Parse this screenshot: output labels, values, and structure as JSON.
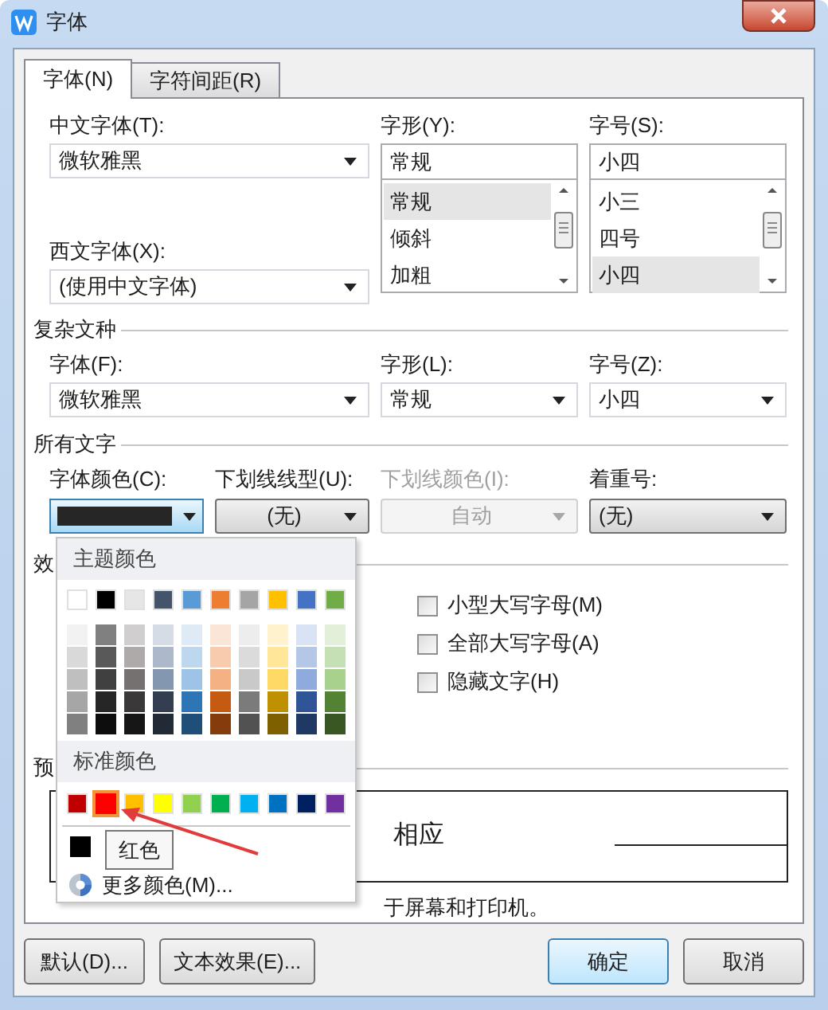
{
  "window": {
    "title": "字体"
  },
  "tabs": [
    {
      "label": "字体(N)",
      "selected": true
    },
    {
      "label": "字符间距(R)",
      "selected": false
    }
  ],
  "fonts": {
    "chinese_font": {
      "label": "中文字体(T):",
      "value": "微软雅黑"
    },
    "western_font": {
      "label": "西文字体(X):",
      "value": "(使用中文字体)"
    },
    "style": {
      "label": "字形(Y):",
      "value": "常规",
      "options": [
        {
          "label": "常规",
          "selected": true
        },
        {
          "label": "倾斜",
          "selected": false
        },
        {
          "label": "加粗",
          "selected": false
        }
      ]
    },
    "size": {
      "label": "字号(S):",
      "value": "小四",
      "options": [
        {
          "label": "小三",
          "selected": false
        },
        {
          "label": "四号",
          "selected": false
        },
        {
          "label": "小四",
          "selected": true
        }
      ]
    }
  },
  "complex": {
    "title": "复杂文种",
    "fields": [
      {
        "label": "字体(F):",
        "value": "微软雅黑"
      },
      {
        "label": "字形(L):",
        "value": "常规"
      },
      {
        "label": "字号(Z):",
        "value": "小四"
      }
    ]
  },
  "all_text": {
    "title": "所有文字",
    "fields": [
      {
        "kind": "color",
        "label": "字体颜色(C):",
        "color": "#262626",
        "disabled": false
      },
      {
        "kind": "button",
        "label": "下划线线型(U):",
        "value": "(无)",
        "disabled": false
      },
      {
        "kind": "button",
        "label": "下划线颜色(I):",
        "value": "自动",
        "disabled": true
      },
      {
        "kind": "dropdown",
        "label": "着重号:",
        "value": "(无)",
        "disabled": false
      }
    ]
  },
  "effects": {
    "title": "效",
    "checkboxes": [
      {
        "label": "小型大写字母(M)",
        "checked": false
      },
      {
        "label": "全部大写字母(A)",
        "checked": false
      },
      {
        "label": "隐藏文字(H)",
        "checked": false
      }
    ]
  },
  "preview": {
    "title": "预",
    "sample": "相应"
  },
  "font_info": "于屏幕和打印机。",
  "color_menu": {
    "theme_title": "主题颜色",
    "theme_colors": [
      {
        "color": "#ffffff"
      },
      {
        "color": "#000000"
      },
      {
        "color": "#e7e6e6"
      },
      {
        "color": "#44546a"
      },
      {
        "color": "#5b9bd5"
      },
      {
        "color": "#ed7d31"
      },
      {
        "color": "#a5a5a5"
      },
      {
        "color": "#ffc000"
      },
      {
        "color": "#4472c4"
      },
      {
        "color": "#70ad47"
      }
    ],
    "shades": [
      {
        "colors": [
          {
            "color": "#f2f2f2"
          },
          {
            "color": "#d9d9d9"
          },
          {
            "color": "#bfbfbf"
          },
          {
            "color": "#a6a6a6"
          },
          {
            "color": "#808080"
          }
        ]
      },
      {
        "colors": [
          {
            "color": "#808080"
          },
          {
            "color": "#595959"
          },
          {
            "color": "#404040"
          },
          {
            "color": "#262626"
          },
          {
            "color": "#0d0d0d"
          }
        ]
      },
      {
        "colors": [
          {
            "color": "#d0cece"
          },
          {
            "color": "#aeaaaa"
          },
          {
            "color": "#757171"
          },
          {
            "color": "#3a3838"
          },
          {
            "color": "#171616"
          }
        ]
      },
      {
        "colors": [
          {
            "color": "#d6dce5"
          },
          {
            "color": "#adb9ca"
          },
          {
            "color": "#8497b0"
          },
          {
            "color": "#333f50"
          },
          {
            "color": "#222a35"
          }
        ]
      },
      {
        "colors": [
          {
            "color": "#deebf7"
          },
          {
            "color": "#bdd7ee"
          },
          {
            "color": "#9dc3e6"
          },
          {
            "color": "#2e75b6"
          },
          {
            "color": "#1f4e79"
          }
        ]
      },
      {
        "colors": [
          {
            "color": "#fbe5d6"
          },
          {
            "color": "#f8cbad"
          },
          {
            "color": "#f4b183"
          },
          {
            "color": "#c55a11"
          },
          {
            "color": "#843c0c"
          }
        ]
      },
      {
        "colors": [
          {
            "color": "#ededed"
          },
          {
            "color": "#dbdbdb"
          },
          {
            "color": "#c9c9c9"
          },
          {
            "color": "#7b7b7b"
          },
          {
            "color": "#525252"
          }
        ]
      },
      {
        "colors": [
          {
            "color": "#fff2cc"
          },
          {
            "color": "#ffe699"
          },
          {
            "color": "#ffd966"
          },
          {
            "color": "#bf9000"
          },
          {
            "color": "#7f6000"
          }
        ]
      },
      {
        "colors": [
          {
            "color": "#dae3f3"
          },
          {
            "color": "#b4c7e7"
          },
          {
            "color": "#8faadc"
          },
          {
            "color": "#2f5597"
          },
          {
            "color": "#203864"
          }
        ]
      },
      {
        "colors": [
          {
            "color": "#e2f0d9"
          },
          {
            "color": "#c5e0b4"
          },
          {
            "color": "#a9d18e"
          },
          {
            "color": "#548235"
          },
          {
            "color": "#385723"
          }
        ]
      }
    ],
    "standard_title": "标准颜色",
    "standard_colors": [
      {
        "color": "#c00000",
        "selected": false
      },
      {
        "color": "#ff0000",
        "selected": true
      },
      {
        "color": "#ffc000",
        "selected": false
      },
      {
        "color": "#ffff00",
        "selected": false
      },
      {
        "color": "#92d050",
        "selected": false
      },
      {
        "color": "#00b050",
        "selected": false
      },
      {
        "color": "#00b0f0",
        "selected": false
      },
      {
        "color": "#0070c0",
        "selected": false
      },
      {
        "color": "#002060",
        "selected": false
      },
      {
        "color": "#7030a0",
        "selected": false
      }
    ],
    "automatic": {
      "color": "#000000"
    },
    "more_colors": "更多颜色(M)...",
    "tooltip": "红色"
  },
  "buttons": [
    {
      "label": "默认(D)...",
      "default": false
    },
    {
      "label": "文本效果(E)...",
      "default": false
    },
    {
      "label": "确定",
      "default": true
    },
    {
      "label": "取消",
      "default": false
    }
  ]
}
